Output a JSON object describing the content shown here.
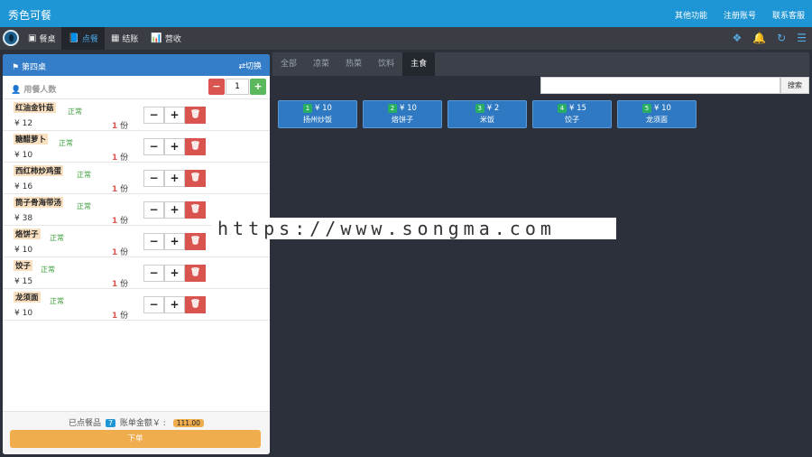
{
  "app": {
    "title": "秀色可餐"
  },
  "top_nav": [
    "其他功能",
    "注册账号",
    "联系客服"
  ],
  "menu": [
    {
      "label": "餐桌",
      "icon": "table-icon",
      "glyph": "▣",
      "active": false
    },
    {
      "label": "点餐",
      "icon": "book-icon",
      "glyph": "📘",
      "active": true
    },
    {
      "label": "结账",
      "icon": "calculator-icon",
      "glyph": "▦",
      "active": false
    },
    {
      "label": "营收",
      "icon": "bar-chart-icon",
      "glyph": "📊",
      "active": false
    }
  ],
  "toolbar_icons": [
    {
      "name": "gift-icon",
      "glyph": "❖"
    },
    {
      "name": "bell-icon",
      "glyph": "🔔"
    },
    {
      "name": "refresh-icon",
      "glyph": "↻"
    },
    {
      "name": "list-icon",
      "glyph": "☰"
    }
  ],
  "order": {
    "table_name": "第四桌",
    "switch_label": "⇄切换",
    "people_label": "用餐人数",
    "people_count": "1",
    "items": [
      {
        "name": "红油金针菇",
        "status": "正常",
        "price": "¥ 12",
        "qty": "1",
        "unit": "份"
      },
      {
        "name": "糖醋萝卜",
        "status": "正常",
        "price": "¥ 10",
        "qty": "1",
        "unit": "份"
      },
      {
        "name": "西红柿炒鸡蛋",
        "status": "正常",
        "price": "¥ 16",
        "qty": "1",
        "unit": "份"
      },
      {
        "name": "筒子骨海带汤",
        "status": "正常",
        "price": "¥ 38",
        "qty": "1",
        "unit": "份"
      },
      {
        "name": "烙饼子",
        "status": "正常",
        "price": "¥ 10",
        "qty": "1",
        "unit": "份"
      },
      {
        "name": "饺子",
        "status": "正常",
        "price": "¥ 15",
        "qty": "1",
        "unit": "份"
      },
      {
        "name": "龙须面",
        "status": "正常",
        "price": "¥ 10",
        "qty": "1",
        "unit": "份"
      }
    ],
    "summary_label": "已点餐品",
    "item_count": "7",
    "amount_label": "账单金额￥ :",
    "amount": "111.00",
    "submit_label": "下单"
  },
  "categories": [
    {
      "label": "全部",
      "active": false
    },
    {
      "label": "凉菜",
      "active": false
    },
    {
      "label": "热菜",
      "active": false
    },
    {
      "label": "饮料",
      "active": false
    },
    {
      "label": "主食",
      "active": true
    }
  ],
  "search": {
    "button_label": "搜索",
    "value": ""
  },
  "dishes": [
    {
      "index": "1",
      "price": "¥ 10",
      "name": "扬州炒饭"
    },
    {
      "index": "2",
      "price": "¥ 10",
      "name": "烙饼子"
    },
    {
      "index": "3",
      "price": "¥ 2",
      "name": "米饭"
    },
    {
      "index": "4",
      "price": "¥ 15",
      "name": "饺子"
    },
    {
      "index": "5",
      "price": "¥ 10",
      "name": "龙须面"
    }
  ],
  "watermark": "https://www.songma.com"
}
